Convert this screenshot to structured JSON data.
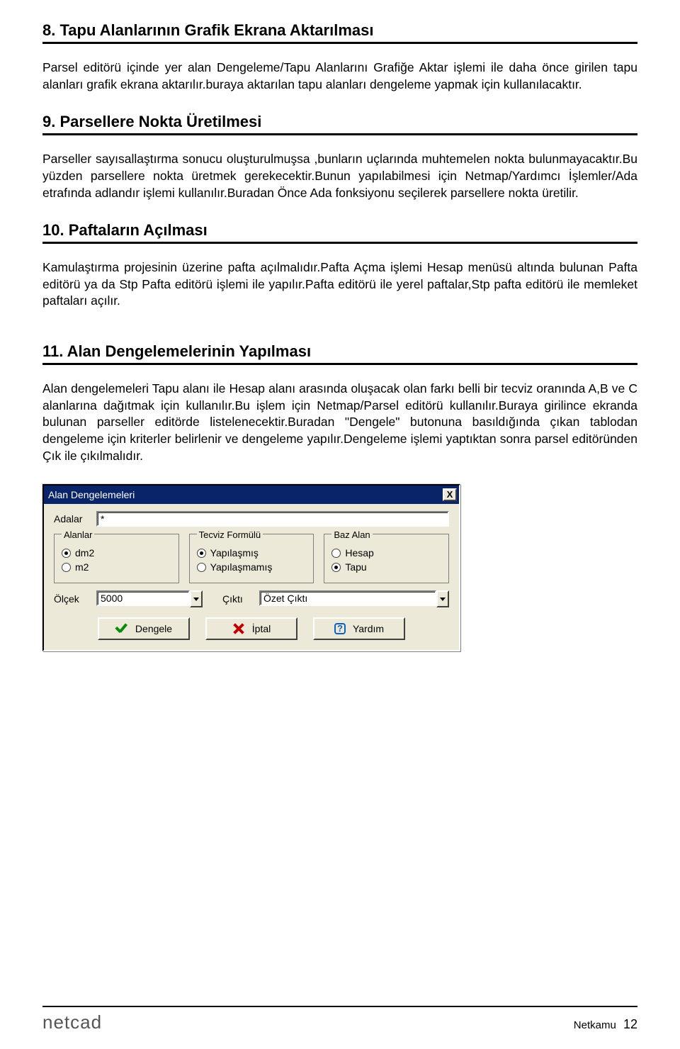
{
  "sections": {
    "s8": {
      "heading": "8. Tapu Alanlarının Grafik Ekrana Aktarılması",
      "para": "Parsel editörü içinde yer alan Dengeleme/Tapu Alanlarını Grafiğe Aktar işlemi ile daha önce girilen tapu alanları grafik ekrana aktarılır.buraya aktarılan tapu alanları dengeleme yapmak için kullanılacaktır."
    },
    "s9": {
      "heading": "9. Parsellere Nokta Üretilmesi",
      "para": "Parseller sayısallaştırma sonucu oluşturulmuşsa ,bunların uçlarında muhtemelen nokta bulunmayacaktır.Bu yüzden parsellere nokta üretmek gerekecektir.Bunun yapılabilmesi için Netmap/Yardımcı İşlemler/Ada etrafında adlandır işlemi kullanılır.Buradan Önce Ada fonksiyonu seçilerek parsellere nokta üretilir."
    },
    "s10": {
      "heading": "10. Paftaların Açılması",
      "para": "Kamulaştırma projesinin üzerine pafta açılmalıdır.Pafta Açma işlemi Hesap menüsü altında bulunan Pafta editörü ya da Stp Pafta editörü işlemi ile yapılır.Pafta editörü ile yerel paftalar,Stp pafta editörü ile memleket paftaları açılır."
    },
    "s11": {
      "heading": "11. Alan Dengelemelerinin Yapılması",
      "para": "Alan dengelemeleri Tapu alanı ile Hesap alanı arasında oluşacak olan farkı belli bir tecviz oranında  A,B ve C alanlarına dağıtmak için kullanılır.Bu işlem için Netmap/Parsel editörü kullanılır.Buraya girilince ekranda bulunan parseller editörde listelenecektir.Buradan \"Dengele\" butonuna basıldığında çıkan tablodan dengeleme için kriterler belirlenir ve dengeleme yapılır.Dengeleme işlemi yaptıktan sonra parsel editöründen Çık ile çıkılmalıdır."
    }
  },
  "dialog": {
    "title": "Alan Dengelemeleri",
    "close": "X",
    "adalar_label": "Adalar",
    "adalar_value": "*",
    "fs_alanlar": {
      "legend": "Alanlar",
      "opt1": "dm2",
      "opt2": "m2",
      "selected": "dm2"
    },
    "fs_tecviz": {
      "legend": "Tecviz Formülü",
      "opt1": "Yapılaşmış",
      "opt2": "Yapılaşmamış",
      "selected": "Yapılaşmış"
    },
    "fs_baz": {
      "legend": "Baz Alan",
      "opt1": "Hesap",
      "opt2": "Tapu",
      "selected": "Tapu"
    },
    "olcek_label": "Ölçek",
    "olcek_value": "5000",
    "cikti_label": "Çıktı",
    "cikti_value": "Özet Çıktı",
    "btn_ok": "Dengele",
    "btn_cancel": "İptal",
    "btn_help": "Yardım"
  },
  "footer": {
    "logo": "netcad",
    "doc": "Netkamu",
    "page": "12"
  }
}
